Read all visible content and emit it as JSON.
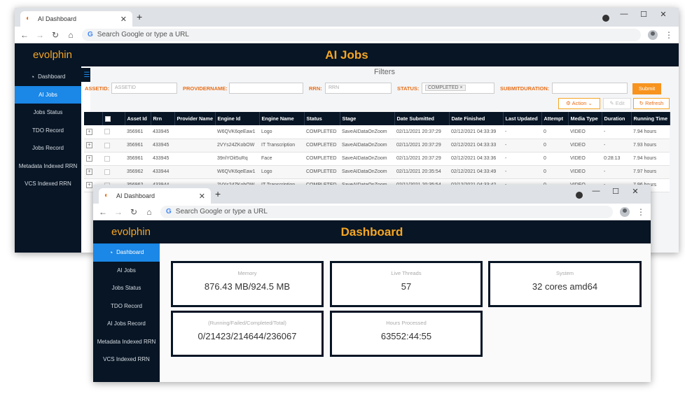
{
  "win1": {
    "tab_title": "AI Dashboard",
    "new_tab": "+",
    "address_placeholder": "Search Google or type a URL",
    "logo": "evolphin",
    "title": "AI Jobs",
    "sidebar": [
      {
        "label": "Dashboard",
        "active": false
      },
      {
        "label": "AI Jobs",
        "active": true
      },
      {
        "label": "Jobs Status",
        "active": false
      },
      {
        "label": "TDO Record",
        "active": false
      },
      {
        "label": "Jobs Record",
        "active": false
      },
      {
        "label": "Metadata Indexed RRN",
        "active": false
      },
      {
        "label": "VCS Indexed RRN",
        "active": false
      }
    ],
    "filters": {
      "title": "Filters",
      "assetid_label": "ASSETID:",
      "assetid_placeholder": "ASSETID",
      "provider_label": "PROVIDERNAME:",
      "rrn_label": "RRN:",
      "rrn_placeholder": "RRN",
      "status_label": "STATUS:",
      "status_chip": "COMPLETED",
      "status_chip_close": "×",
      "submitdur_label": "SUBMITDURATION:",
      "submit": "Submit",
      "action": "Action",
      "edit": "Edit",
      "refresh": "Refresh"
    },
    "columns": [
      "Asset Id",
      "Rrn",
      "Provider Name",
      "Engine Id",
      "Engine Name",
      "Status",
      "Stage",
      "Date Submitted",
      "Date Finished",
      "Last Updated",
      "Attempt",
      "Media Type",
      "Duration",
      "Running Time"
    ],
    "rows": [
      [
        "356961",
        "433945",
        "",
        "W6QVK6qeEaw1",
        "Logo",
        "COMPLETED",
        "SaveAIDataOnZoom",
        "02/11/2021 20:37:29",
        "02/12/2021 04:33:39",
        "-",
        "0",
        "VIDEO",
        "-",
        "7.94 hours"
      ],
      [
        "356961",
        "433945",
        "",
        "2VYs24ZKobOW",
        "IT Transcription",
        "COMPLETED",
        "SaveAIDataOnZoom",
        "02/11/2021 20:37:29",
        "02/12/2021 04:33:33",
        "-",
        "0",
        "VIDEO",
        "-",
        "7.93 hours"
      ],
      [
        "356961",
        "433945",
        "",
        "39nlYOit5uRq",
        "Face",
        "COMPLETED",
        "SaveAIDataOnZoom",
        "02/11/2021 20:37:29",
        "02/12/2021 04:33:36",
        "-",
        "0",
        "VIDEO",
        "0:28:13",
        "7.94 hours"
      ],
      [
        "356962",
        "433944",
        "",
        "W6QVK6qeEaw1",
        "Logo",
        "COMPLETED",
        "SaveAIDataOnZoom",
        "02/11/2021 20:35:54",
        "02/12/2021 04:33:49",
        "-",
        "0",
        "VIDEO",
        "-",
        "7.97 hours"
      ],
      [
        "356962",
        "433944",
        "",
        "2VYs24ZKobOW",
        "IT Transcription",
        "COMPLETED",
        "SaveAIDataOnZoom",
        "02/11/2021 20:35:54",
        "02/12/2021 04:33:42",
        "-",
        "0",
        "VIDEO",
        "-",
        "7.96 hours"
      ]
    ]
  },
  "win2": {
    "tab_title": "AI Dashboard",
    "new_tab": "+",
    "address_placeholder": "Search Google or type a URL",
    "logo": "evolphin",
    "title": "Dashboard",
    "sidebar": [
      {
        "label": "Dashboard",
        "active": true
      },
      {
        "label": "AI Jobs",
        "active": false
      },
      {
        "label": "Jobs Status",
        "active": false
      },
      {
        "label": "TDO Record",
        "active": false
      },
      {
        "label": "AI Jobs Record",
        "active": false
      },
      {
        "label": "Metadata Indexed RRN",
        "active": false
      },
      {
        "label": "VCS Indexed RRN",
        "active": false
      }
    ],
    "cards": [
      {
        "label": "Memory",
        "value": "876.43 MB/924.5 MB"
      },
      {
        "label": "Live Threads",
        "value": "57"
      },
      {
        "label": "System",
        "value": "32 cores amd64"
      },
      {
        "label": "(Running/Failed/Completed/Total)",
        "value": "0/21423/214644/236067"
      },
      {
        "label": "Hours Processed",
        "value": "63552:44:55"
      }
    ]
  },
  "colors": {
    "navy": "#071525",
    "orange": "#f5a623",
    "blue": "#1b87e6"
  }
}
